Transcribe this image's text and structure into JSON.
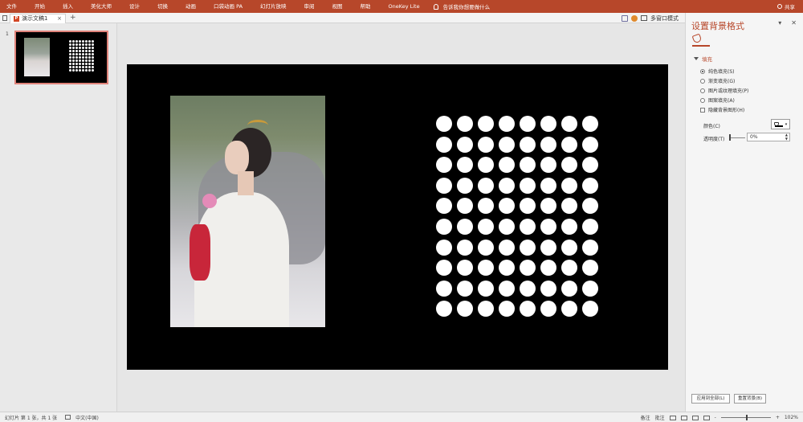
{
  "ribbon": {
    "tabs": [
      "文件",
      "开始",
      "插入",
      "美化大师",
      "设计",
      "切换",
      "动画",
      "口袋动画 PA",
      "幻灯片放映",
      "审阅",
      "视图",
      "帮助",
      "OneKey Lite"
    ],
    "tell_me": "告诉我你想要做什么",
    "share": "共享"
  },
  "tabbar": {
    "doc_tab": "演示文稿1",
    "close": "×",
    "add": "+",
    "multi_window": "多窗口模式"
  },
  "thumbnails": {
    "slide_number": "1"
  },
  "format_pane": {
    "title": "设置背景格式",
    "section": "填充",
    "options": [
      {
        "label": "纯色填充(S)",
        "selected": true
      },
      {
        "label": "渐变填充(G)",
        "selected": false
      },
      {
        "label": "图片或纹理填充(P)",
        "selected": false
      },
      {
        "label": "图案填充(A)",
        "selected": false
      }
    ],
    "hide_bg": "隐藏背景图形(H)",
    "color_label": "颜色(C)",
    "transparency_label": "透明度(T)",
    "transparency_value": "0%",
    "apply_all": "应用到全部(L)",
    "reset": "重置背景(B)"
  },
  "statusbar": {
    "slide_info": "幻灯片 第 1 张，共 1 张",
    "language": "中文(中国)",
    "notes": "备注",
    "comments": "批注",
    "zoom": "102%",
    "zoom_minus": "-",
    "zoom_plus": "+"
  },
  "colors": {
    "accent": "#b7472a",
    "slide_bg": "#000000",
    "dot": "#ffffff"
  }
}
